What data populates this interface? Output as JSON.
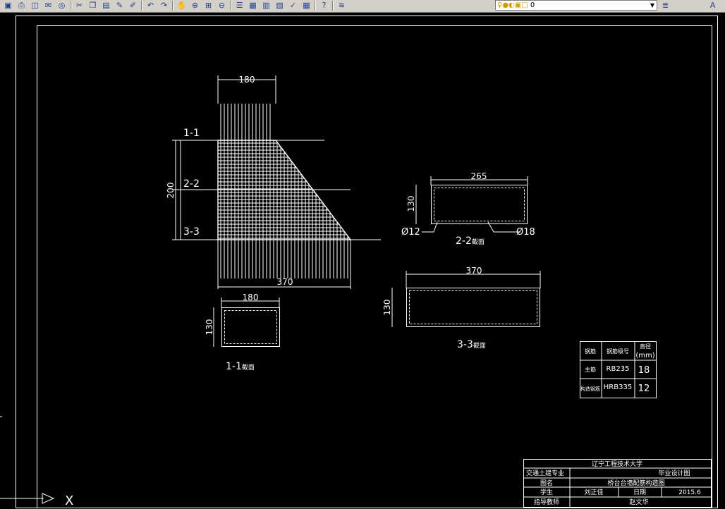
{
  "toolbar": {
    "icons": [
      "save-icon",
      "print-icon",
      "plot-preview-icon",
      "publish-icon",
      "web-icon",
      "cut-icon",
      "copy-icon",
      "paste-icon",
      "match-properties-icon",
      "brush-icon",
      "undo-icon",
      "redo-icon",
      "pan-icon",
      "zoom-realtime-icon",
      "zoom-window-icon",
      "zoom-previous-icon",
      "properties-icon",
      "design-center-icon",
      "tool-palette-icon",
      "sheet-set-icon",
      "markup-icon",
      "calculator-icon",
      "help-icon",
      "layer-manager-icon",
      "layer-state-icon",
      "text-style-icon"
    ],
    "layer_value": "0"
  },
  "drawing": {
    "elevation": {
      "top_dim": "180",
      "height_dim": "200",
      "bottom_dim": "370",
      "sec1": "1-1",
      "sec2": "2-2",
      "sec3": "3-3"
    },
    "section_1_1": {
      "width": "180",
      "height": "130",
      "title_num": "1-1",
      "title_suffix": "截面"
    },
    "section_2_2": {
      "width": "265",
      "height": "130",
      "left_bar": "Ø12",
      "right_bar": "Ø18",
      "title_num": "2-2",
      "title_suffix": "截面"
    },
    "section_3_3": {
      "width": "370",
      "height": "130",
      "title_num": "3-3",
      "title_suffix": "截面"
    },
    "rebar_table": {
      "headers": [
        "钢筋",
        "钢筋级号",
        "直径",
        "(mm)"
      ],
      "rows": [
        {
          "name": "主筋",
          "grade": "RB235",
          "dia": "18"
        },
        {
          "name": "构造钢筋",
          "grade": "HRB335",
          "dia": "12"
        }
      ]
    },
    "title_block": {
      "university": "辽宁工程技术大学",
      "major": "交通土建专业",
      "design_type": "毕业设计图",
      "drawing_name_label": "图名",
      "drawing_name": "桥台台墙配筋构造图",
      "student_label": "学生",
      "student": "刘正佳",
      "date_label": "日期",
      "date": "2015.6",
      "advisor_label": "指导教师",
      "advisor": "赵文华"
    },
    "ucs_label": "X"
  }
}
